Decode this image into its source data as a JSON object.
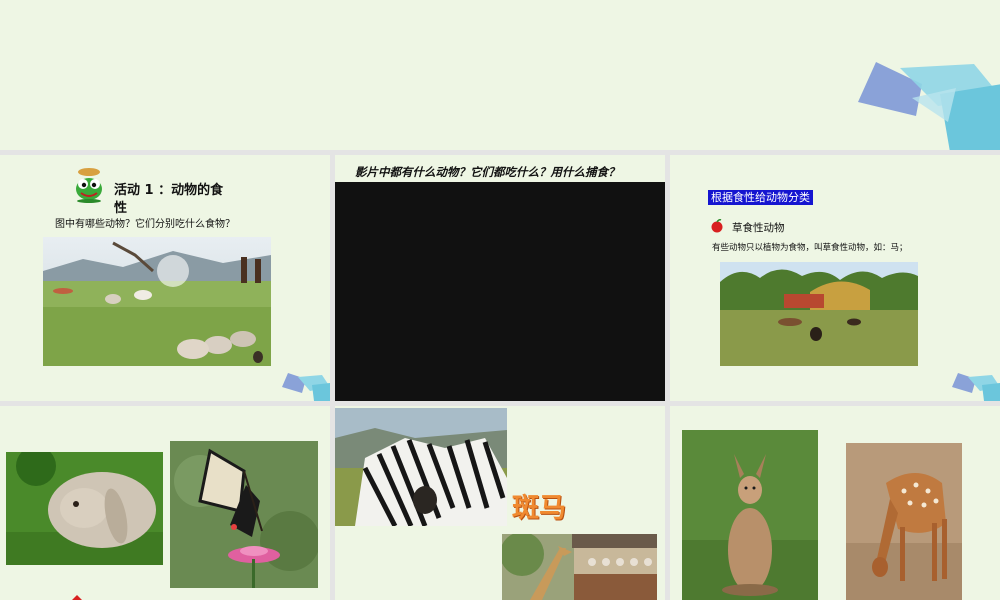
{
  "slides": {
    "s2": {
      "title_line1": "活动 1 ：动物的食",
      "title_line2": "性",
      "question": "图中有哪些动物？它们分别吃什么食物？"
    },
    "s3": {
      "question": "影片中都有什么动物？它们都吃什么？用什么捕食？"
    },
    "s4": {
      "badge": "根据食性给动物分类",
      "heading": "草食性动物",
      "description": "有些动物只以植物为食物，叫草食性动物，如：马；"
    },
    "s6": {
      "wordart": "斑马"
    }
  },
  "colors": {
    "slide_bg": "#eef6e4",
    "badge_bg": "#1515d0",
    "video_bg": "#111111",
    "wordart": "#f08a30"
  },
  "icons": [
    "frog-mascot-icon",
    "apple-bullet-icon",
    "corner-geometric-decoration"
  ]
}
